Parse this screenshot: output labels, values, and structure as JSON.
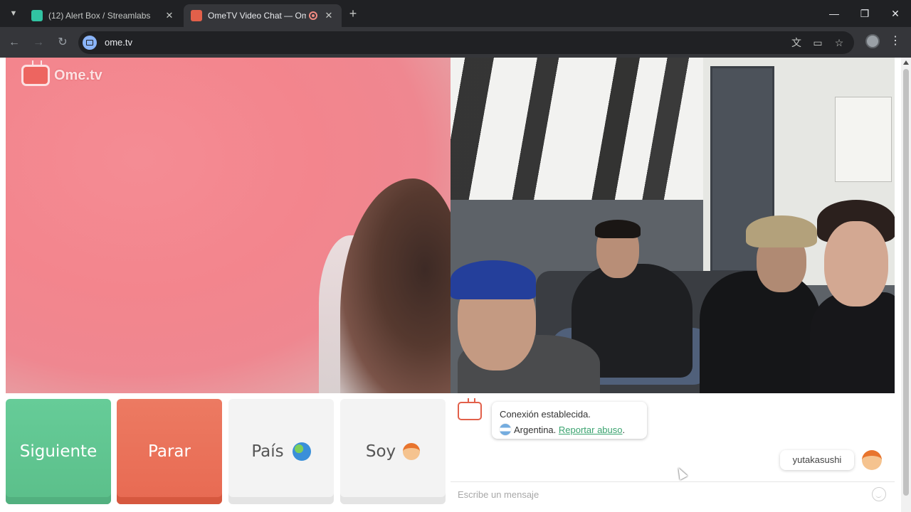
{
  "browser": {
    "tabs": [
      {
        "title": "(12) Alert Box / Streamlabs",
        "active": false,
        "favicon_color": "#31c3a2"
      },
      {
        "title": "OmeTV Video Chat — Ome",
        "active": true,
        "favicon_color": "#e2604a",
        "recording": true
      }
    ],
    "url": "ome.tv",
    "icons": {
      "tab_list": "chevron-down-icon",
      "close": "close-icon",
      "new_tab": "plus-icon",
      "back": "back-arrow-icon",
      "forward": "forward-arrow-icon",
      "reload": "reload-icon",
      "translate": "translate-icon",
      "cast": "cast-icon",
      "bookmark": "star-icon",
      "profile": "profile-icon",
      "menu": "kebab-menu-icon"
    }
  },
  "site": {
    "logo_badge": "Ome\nTV",
    "logo_text": "Ome.tv",
    "brand_color": "#e2604a"
  },
  "controls": {
    "next_label": "Siguiente",
    "stop_label": "Parar",
    "country_label": "País",
    "gender_label": "Soy",
    "next_color": "#5bbf8a",
    "stop_color": "#e86a52"
  },
  "chat": {
    "system_line1": "Conexión establecida.",
    "country": "Argentina.",
    "report_link": "Reportar abuso",
    "report_suffix": ".",
    "own_username": "yutakasushi",
    "input_placeholder": "Escribe un mensaje",
    "link_color": "#3aa36f"
  }
}
